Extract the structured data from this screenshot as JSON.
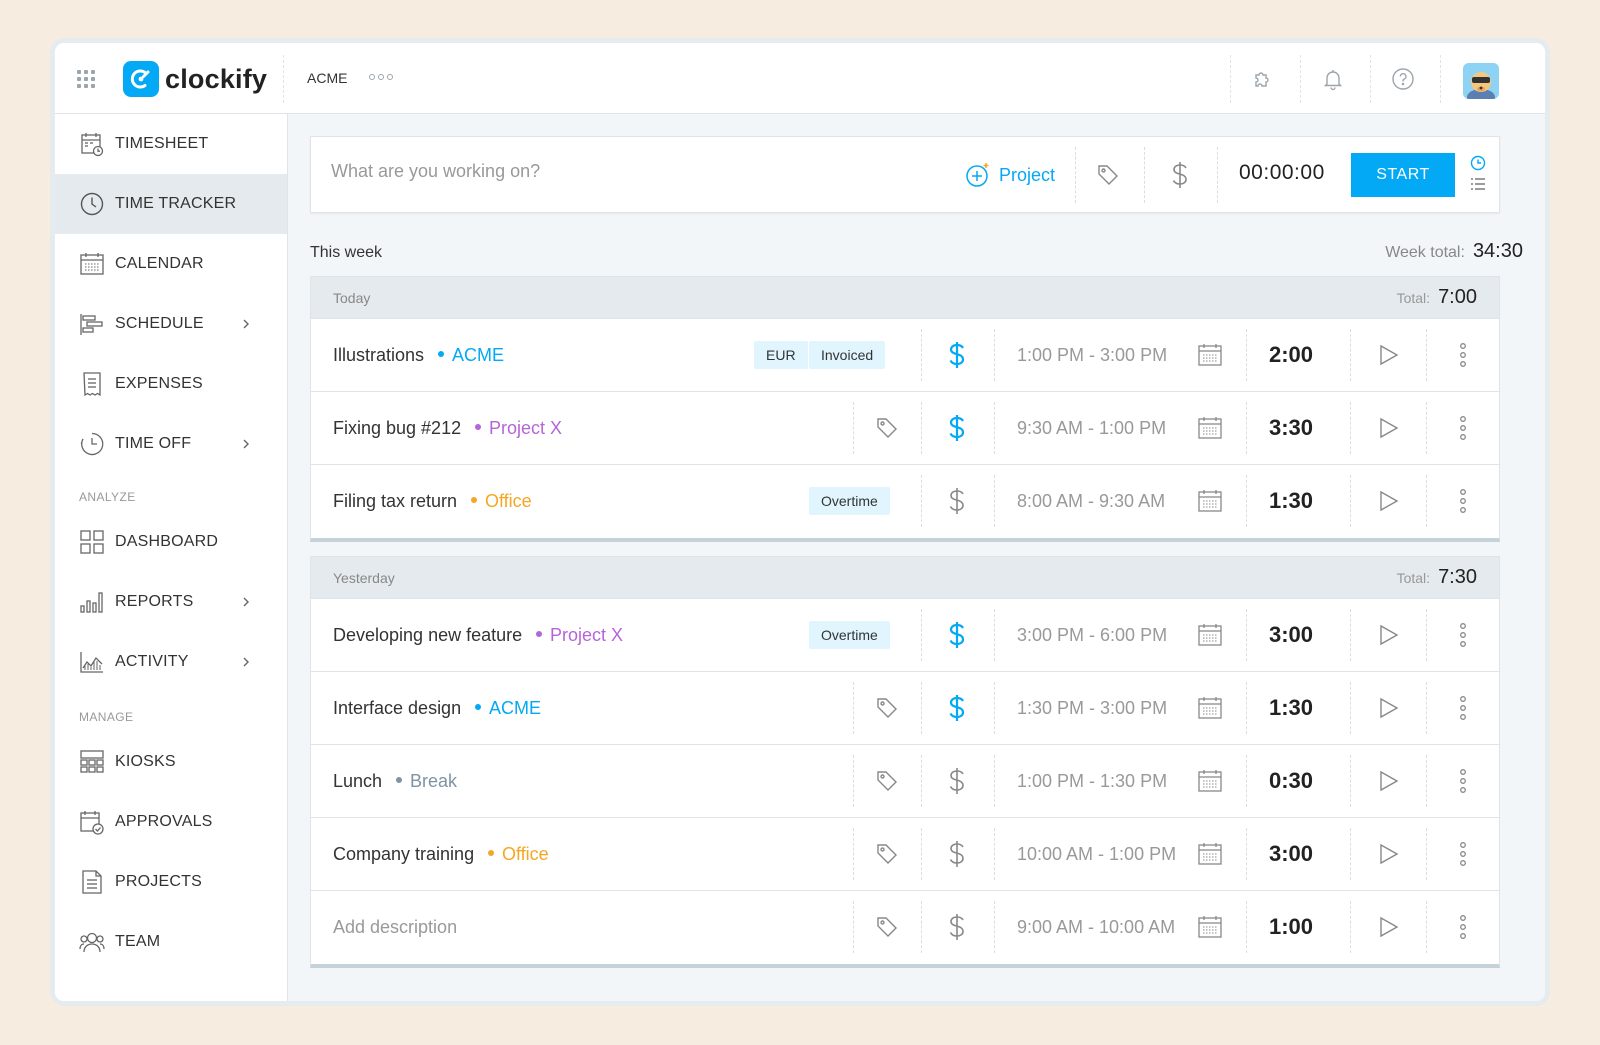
{
  "header": {
    "logo_text": "clockify",
    "workspace": "ACME",
    "icons": [
      "apps-grid-icon",
      "puzzle-icon",
      "bell-icon",
      "help-icon"
    ]
  },
  "sidebar": {
    "items": [
      {
        "label": "TIMESHEET",
        "icon": "timesheet-icon",
        "active": false,
        "chevron": false
      },
      {
        "label": "TIME TRACKER",
        "icon": "clock-icon",
        "active": true,
        "chevron": false
      },
      {
        "label": "CALENDAR",
        "icon": "calendar-icon",
        "active": false,
        "chevron": false
      },
      {
        "label": "SCHEDULE",
        "icon": "schedule-icon",
        "active": false,
        "chevron": true
      },
      {
        "label": "EXPENSES",
        "icon": "receipt-icon",
        "active": false,
        "chevron": false
      },
      {
        "label": "TIME OFF",
        "icon": "time-off-icon",
        "active": false,
        "chevron": true
      }
    ],
    "analyze_label": "ANALYZE",
    "analyze_items": [
      {
        "label": "DASHBOARD",
        "icon": "dashboard-icon",
        "chevron": false
      },
      {
        "label": "REPORTS",
        "icon": "bar-chart-icon",
        "chevron": true
      },
      {
        "label": "ACTIVITY",
        "icon": "activity-icon",
        "chevron": true
      }
    ],
    "manage_label": "MANAGE",
    "manage_items": [
      {
        "label": "KIOSKS",
        "icon": "kiosk-icon",
        "chevron": false
      },
      {
        "label": "APPROVALS",
        "icon": "approvals-icon",
        "chevron": false
      },
      {
        "label": "PROJECTS",
        "icon": "document-icon",
        "chevron": false
      },
      {
        "label": "TEAM",
        "icon": "team-icon",
        "chevron": false
      }
    ]
  },
  "timer": {
    "placeholder": "What are you working on?",
    "project_label": "Project",
    "clock": "00:00:00",
    "start_label": "START"
  },
  "week": {
    "label": "This week",
    "total_label": "Week total:",
    "total": "34:30"
  },
  "colors": {
    "accent": "#03a9f4",
    "acme": "#03a9f4",
    "project_x": "#b565d8",
    "office": "#f5a623",
    "break": "#7e93a6"
  },
  "days": [
    {
      "label": "Today",
      "total_label": "Total:",
      "total": "7:00",
      "entries": [
        {
          "description": "Illustrations",
          "project": "ACME",
          "project_color": "#03a9f4",
          "chips": [
            "EUR",
            "Invoiced"
          ],
          "tag": false,
          "billable": true,
          "time_range": "1:00 PM - 3:00 PM",
          "duration": "2:00"
        },
        {
          "description": "Fixing bug #212",
          "project": "Project X",
          "project_color": "#b565d8",
          "chips": [],
          "tag": true,
          "billable": true,
          "time_range": "9:30 AM - 1:00 PM",
          "duration": "3:30"
        },
        {
          "description": "Filing tax return",
          "project": "Office",
          "project_color": "#f5a623",
          "chips": [
            "Overtime"
          ],
          "tag": false,
          "billable": false,
          "time_range": "8:00 AM - 9:30 AM",
          "duration": "1:30"
        }
      ]
    },
    {
      "label": "Yesterday",
      "total_label": "Total:",
      "total": "7:30",
      "entries": [
        {
          "description": "Developing new feature",
          "project": "Project X",
          "project_color": "#b565d8",
          "chips": [
            "Overtime"
          ],
          "tag": false,
          "billable": true,
          "time_range": "3:00 PM - 6:00 PM",
          "duration": "3:00"
        },
        {
          "description": "Interface design",
          "project": "ACME",
          "project_color": "#03a9f4",
          "chips": [],
          "tag": true,
          "billable": true,
          "time_range": "1:30 PM - 3:00 PM",
          "duration": "1:30"
        },
        {
          "description": "Lunch",
          "project": "Break",
          "project_color": "#7e93a6",
          "chips": [],
          "tag": true,
          "billable": false,
          "time_range": "1:00 PM - 1:30 PM",
          "duration": "0:30"
        },
        {
          "description": "Company training",
          "project": "Office",
          "project_color": "#f5a623",
          "chips": [],
          "tag": true,
          "billable": false,
          "time_range": "10:00 AM - 1:00 PM",
          "duration": "3:00"
        },
        {
          "description": "Add description",
          "project": "",
          "project_color": "",
          "chips": [],
          "tag": true,
          "billable": false,
          "placeholder": true,
          "time_range": "9:00 AM - 10:00 AM",
          "duration": "1:00"
        }
      ]
    }
  ]
}
